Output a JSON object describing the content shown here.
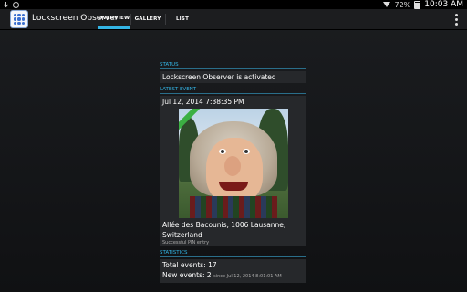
{
  "status_bar": {
    "left_icons": [
      "download-icon",
      "alarm-icon"
    ],
    "battery": "72%",
    "time": "10:03 AM"
  },
  "action_bar": {
    "app_title": "Lockscreen Observer",
    "tabs": [
      {
        "label": "OVERVIEW",
        "active": true
      },
      {
        "label": "GALLERY",
        "active": false
      },
      {
        "label": "LIST",
        "active": false
      }
    ]
  },
  "status_section": {
    "header": "STATUS",
    "text": "Lockscreen Observer is activated"
  },
  "latest_event": {
    "header": "LATEST EVENT",
    "timestamp": "Jul 12, 2014 7:38:35 PM",
    "location": "Allée des Bacounis, 1006 Lausanne, Switzerland",
    "description": "Successful PIN entry"
  },
  "statistics": {
    "header": "STATISTICS",
    "total": "Total events: 17",
    "new": "New events: 2",
    "new_since": "since Jul 12, 2014 8:01:01 AM"
  },
  "colors": {
    "accent": "#33b5e5",
    "card": "#26282b"
  }
}
